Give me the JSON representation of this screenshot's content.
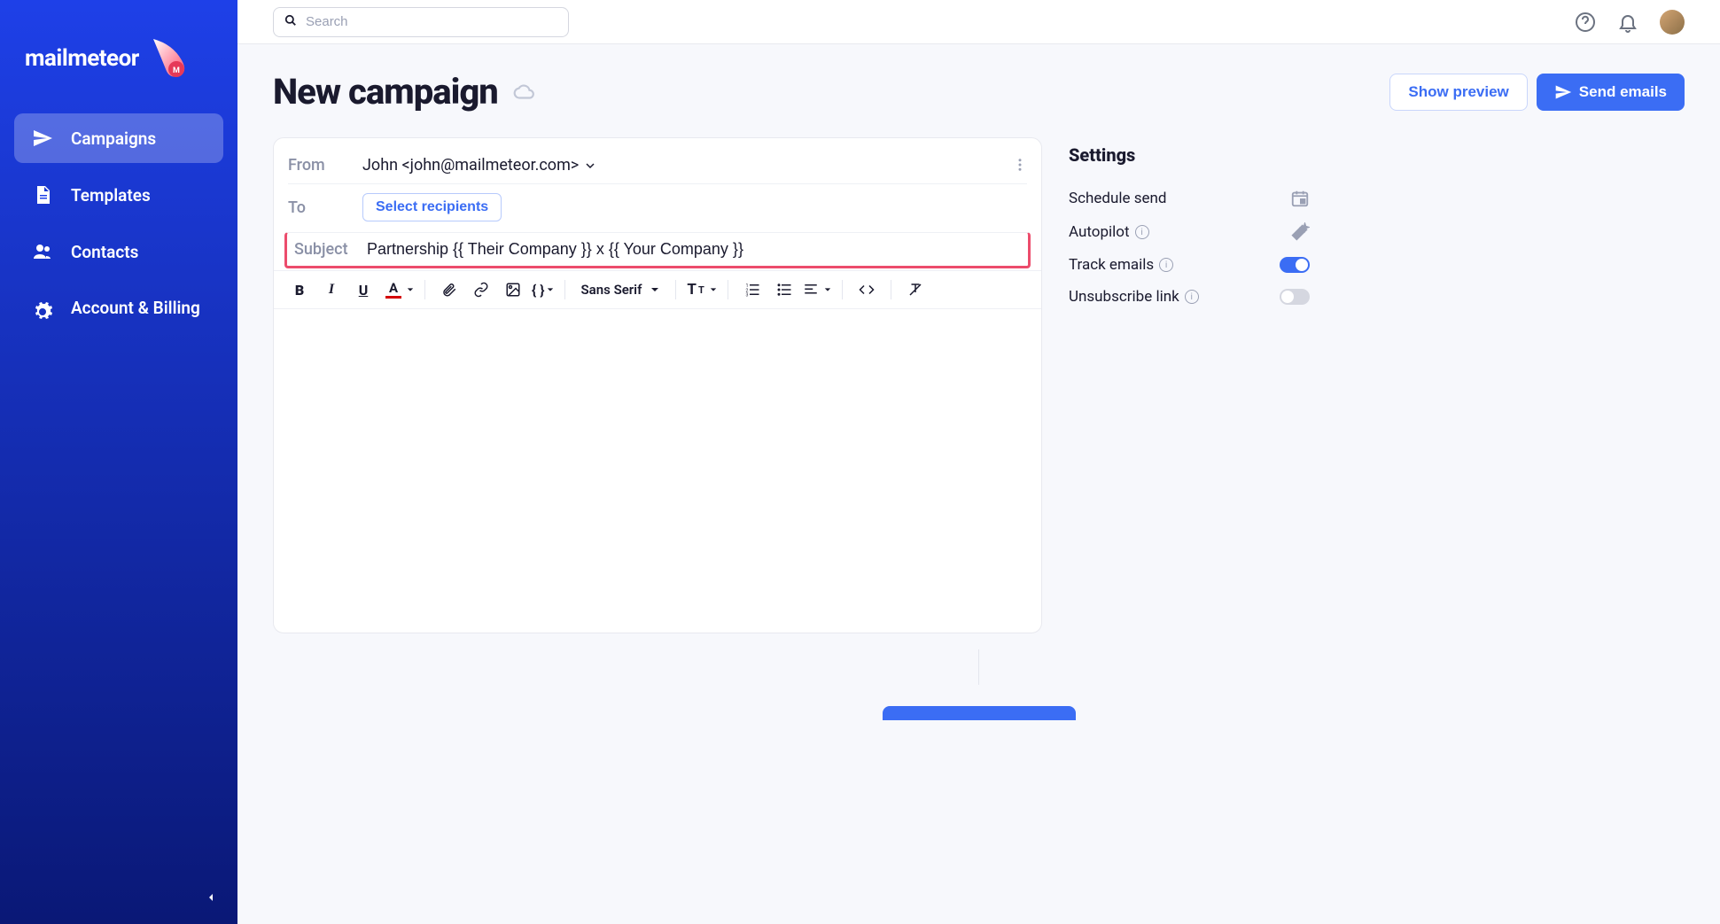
{
  "brand": {
    "name": "mailmeteor"
  },
  "search": {
    "placeholder": "Search"
  },
  "nav": {
    "campaigns": "Campaigns",
    "templates": "Templates",
    "contacts": "Contacts",
    "account": "Account & Billing"
  },
  "page": {
    "title": "New campaign",
    "show_preview": "Show preview",
    "send_emails": "Send emails"
  },
  "composer": {
    "from_label": "From",
    "from_value": "John <john@mailmeteor.com>",
    "to_label": "To",
    "select_recipients": "Select recipients",
    "subject_label": "Subject",
    "subject_value": "Partnership {{ Their Company }} x {{ Your Company }}"
  },
  "toolbar": {
    "font": "Sans Serif"
  },
  "settings": {
    "title": "Settings",
    "schedule": "Schedule send",
    "autopilot": "Autopilot",
    "track": "Track emails",
    "unsubscribe": "Unsubscribe link",
    "track_on": true,
    "unsubscribe_on": false
  }
}
